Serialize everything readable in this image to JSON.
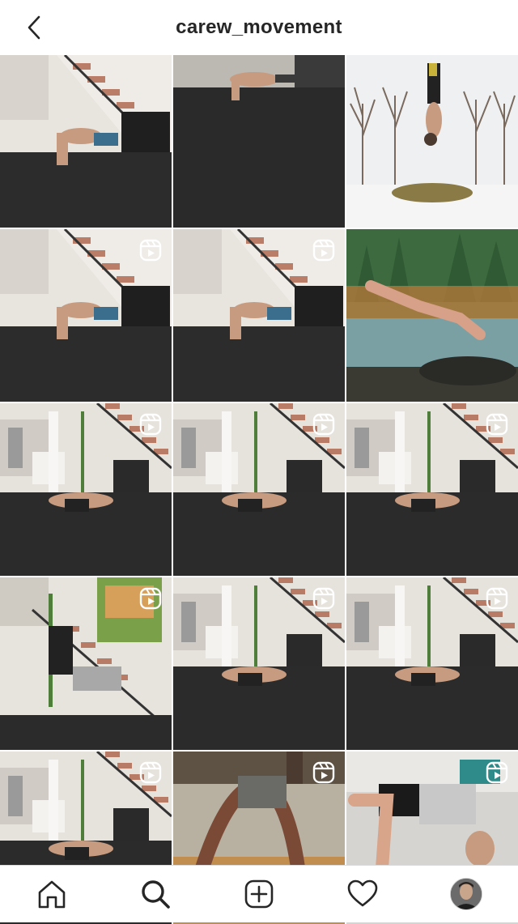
{
  "header": {
    "title": "carew_movement",
    "back_icon": "chevron-left-icon"
  },
  "grid": {
    "posts": [
      {
        "scene": "studio-stairs",
        "reel": false
      },
      {
        "scene": "studio-dark",
        "reel": false
      },
      {
        "scene": "snow-trees",
        "reel": false
      },
      {
        "scene": "studio-stairs",
        "reel": true
      },
      {
        "scene": "studio-stairs",
        "reel": true
      },
      {
        "scene": "lake-forest",
        "reel": false
      },
      {
        "scene": "kitchen-studio",
        "reel": true
      },
      {
        "scene": "kitchen-studio",
        "reel": true
      },
      {
        "scene": "kitchen-studio",
        "reel": true
      },
      {
        "scene": "loft-painting",
        "reel": true
      },
      {
        "scene": "kitchen-studio",
        "reel": true
      },
      {
        "scene": "kitchen-studio",
        "reel": true
      },
      {
        "scene": "kitchen-studio",
        "reel": true
      },
      {
        "scene": "gym-wood",
        "reel": true
      },
      {
        "scene": "light-floor",
        "reel": true
      }
    ]
  },
  "tabbar": {
    "items": [
      {
        "icon": "home-icon"
      },
      {
        "icon": "search-icon",
        "active": true
      },
      {
        "icon": "add-post-icon"
      },
      {
        "icon": "heart-icon"
      },
      {
        "icon": "profile-avatar"
      }
    ]
  },
  "colors": {
    "text": "#262626",
    "divider": "#dbdbdb",
    "floor": "#2c2c2c",
    "wall": "#e9e6e1",
    "stair_accent": "#b06a52"
  }
}
